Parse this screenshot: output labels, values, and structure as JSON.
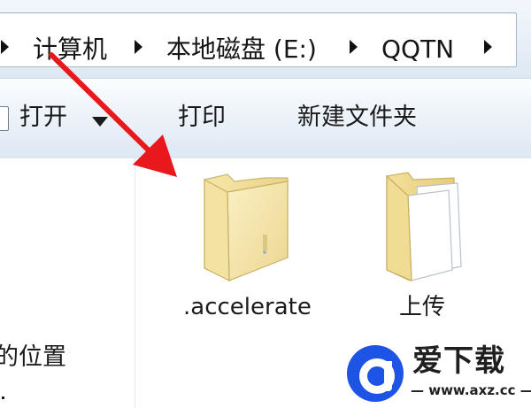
{
  "address_bar": {
    "breadcrumbs": [
      "计算机",
      "本地磁盘 (E:)",
      "QQTN"
    ]
  },
  "toolbar": {
    "open_label": "打开",
    "print_label": "打印",
    "new_folder_label": "新建文件夹"
  },
  "nav_pane": {
    "partial_label": "的位置"
  },
  "content": {
    "items": [
      {
        "name": ".accelerate",
        "icon": "folder-icon"
      },
      {
        "name": "上传",
        "icon": "folder-with-documents-icon"
      }
    ]
  },
  "annotation": {
    "color": "#e8191c"
  },
  "watermark": {
    "title": "爱下载",
    "url": "— www.axz.cc —",
    "brand_color": "#1d54e6"
  }
}
